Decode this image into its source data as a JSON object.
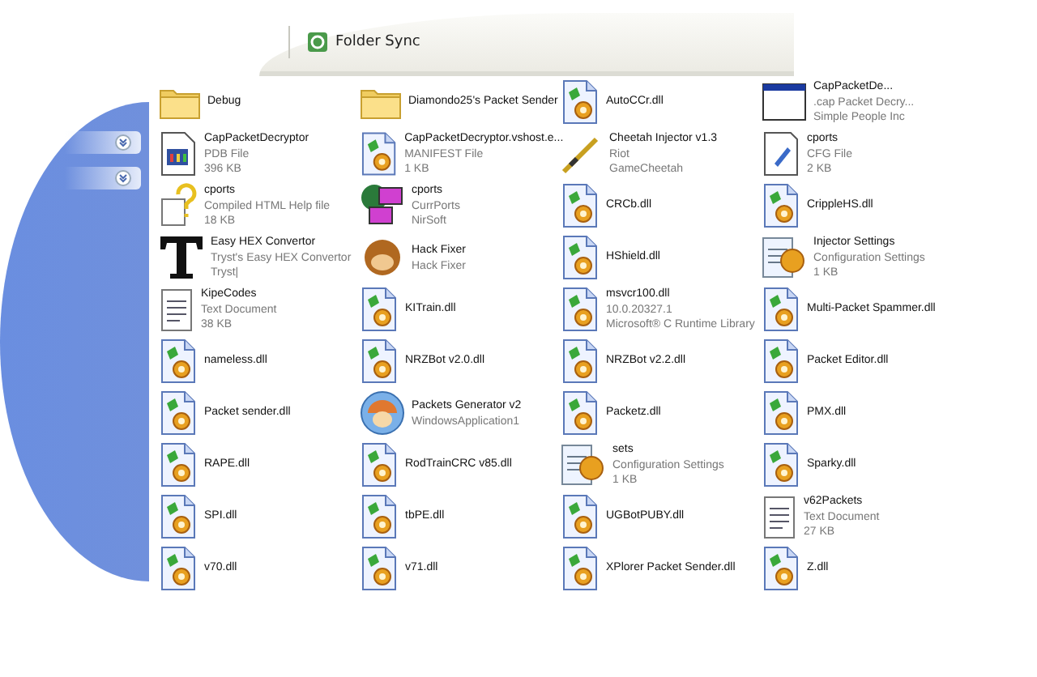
{
  "toolbar": {
    "items": [
      {
        "label": "Folder Sync"
      }
    ]
  },
  "sidebar": {
    "sections": [
      {
        "expanded": false
      },
      {
        "expanded": false
      }
    ]
  },
  "files": [
    {
      "kind": "folder",
      "name": "Debug"
    },
    {
      "kind": "folder",
      "name": "Diamondo25's Packet Sender"
    },
    {
      "kind": "dll",
      "name": "AutoCCr.dll"
    },
    {
      "kind": "exe",
      "name": "CapPacketDe...",
      "lines": [
        ".cap Packet Decry...",
        "Simple People Inc"
      ]
    },
    {
      "kind": "pdb",
      "name": "CapPacketDecryptor",
      "lines": [
        "PDB File",
        "396 KB"
      ]
    },
    {
      "kind": "dll",
      "name": "CapPacketDecryptor.vshost.e...",
      "lines": [
        "MANIFEST File",
        "1 KB"
      ]
    },
    {
      "kind": "syringe",
      "name": "Cheetah Injector v1.3",
      "lines": [
        "Riot",
        "GameCheetah"
      ]
    },
    {
      "kind": "cfg",
      "name": "cports",
      "lines": [
        "CFG File",
        "2 KB"
      ]
    },
    {
      "kind": "help",
      "name": "cports",
      "lines": [
        "Compiled HTML Help file",
        "18 KB"
      ]
    },
    {
      "kind": "network",
      "name": "cports",
      "lines": [
        "CurrPorts",
        "NirSoft"
      ]
    },
    {
      "kind": "dll",
      "name": "CRCb.dll"
    },
    {
      "kind": "dll",
      "name": "CrippleHS.dll"
    },
    {
      "kind": "font",
      "name": "Easy HEX Convertor",
      "lines": [
        "Tryst's Easy HEX Convertor",
        "Tryst|"
      ]
    },
    {
      "kind": "monkey",
      "name": "Hack Fixer",
      "lines": [
        "Hack Fixer"
      ]
    },
    {
      "kind": "dll",
      "name": "HShield.dll"
    },
    {
      "kind": "config",
      "name": "Injector Settings",
      "lines": [
        "Configuration Settings",
        "1 KB"
      ]
    },
    {
      "kind": "text",
      "name": "KipeCodes",
      "lines": [
        "Text Document",
        "38 KB"
      ]
    },
    {
      "kind": "dll",
      "name": "KITrain.dll"
    },
    {
      "kind": "dll",
      "name": "msvcr100.dll",
      "lines": [
        "10.0.20327.1",
        "Microsoft® C Runtime Library"
      ]
    },
    {
      "kind": "dll",
      "name": "Multi-Packet Spammer.dll"
    },
    {
      "kind": "dll",
      "name": "nameless.dll"
    },
    {
      "kind": "dll",
      "name": "NRZBot v2.0.dll"
    },
    {
      "kind": "dll",
      "name": "NRZBot v2.2.dll"
    },
    {
      "kind": "dll",
      "name": "Packet Editor.dll"
    },
    {
      "kind": "dll",
      "name": "Packet sender.dll"
    },
    {
      "kind": "mushroom",
      "name": "Packets Generator v2",
      "lines": [
        "WindowsApplication1"
      ]
    },
    {
      "kind": "dll",
      "name": "Packetz.dll"
    },
    {
      "kind": "dll",
      "name": "PMX.dll"
    },
    {
      "kind": "dll",
      "name": "RAPE.dll"
    },
    {
      "kind": "dll",
      "name": "RodTrainCRC v85.dll"
    },
    {
      "kind": "config",
      "name": "sets",
      "lines": [
        "Configuration Settings",
        "1 KB"
      ]
    },
    {
      "kind": "dll",
      "name": "Sparky.dll"
    },
    {
      "kind": "dll",
      "name": "SPI.dll"
    },
    {
      "kind": "dll",
      "name": "tbPE.dll"
    },
    {
      "kind": "dll",
      "name": "UGBotPUBY.dll"
    },
    {
      "kind": "text",
      "name": "v62Packets",
      "lines": [
        "Text Document",
        "27 KB"
      ]
    },
    {
      "kind": "dll",
      "name": "v70.dll"
    },
    {
      "kind": "dll",
      "name": "v71.dll"
    },
    {
      "kind": "dll",
      "name": "XPlorer Packet Sender.dll"
    },
    {
      "kind": "dll",
      "name": "Z.dll"
    }
  ]
}
